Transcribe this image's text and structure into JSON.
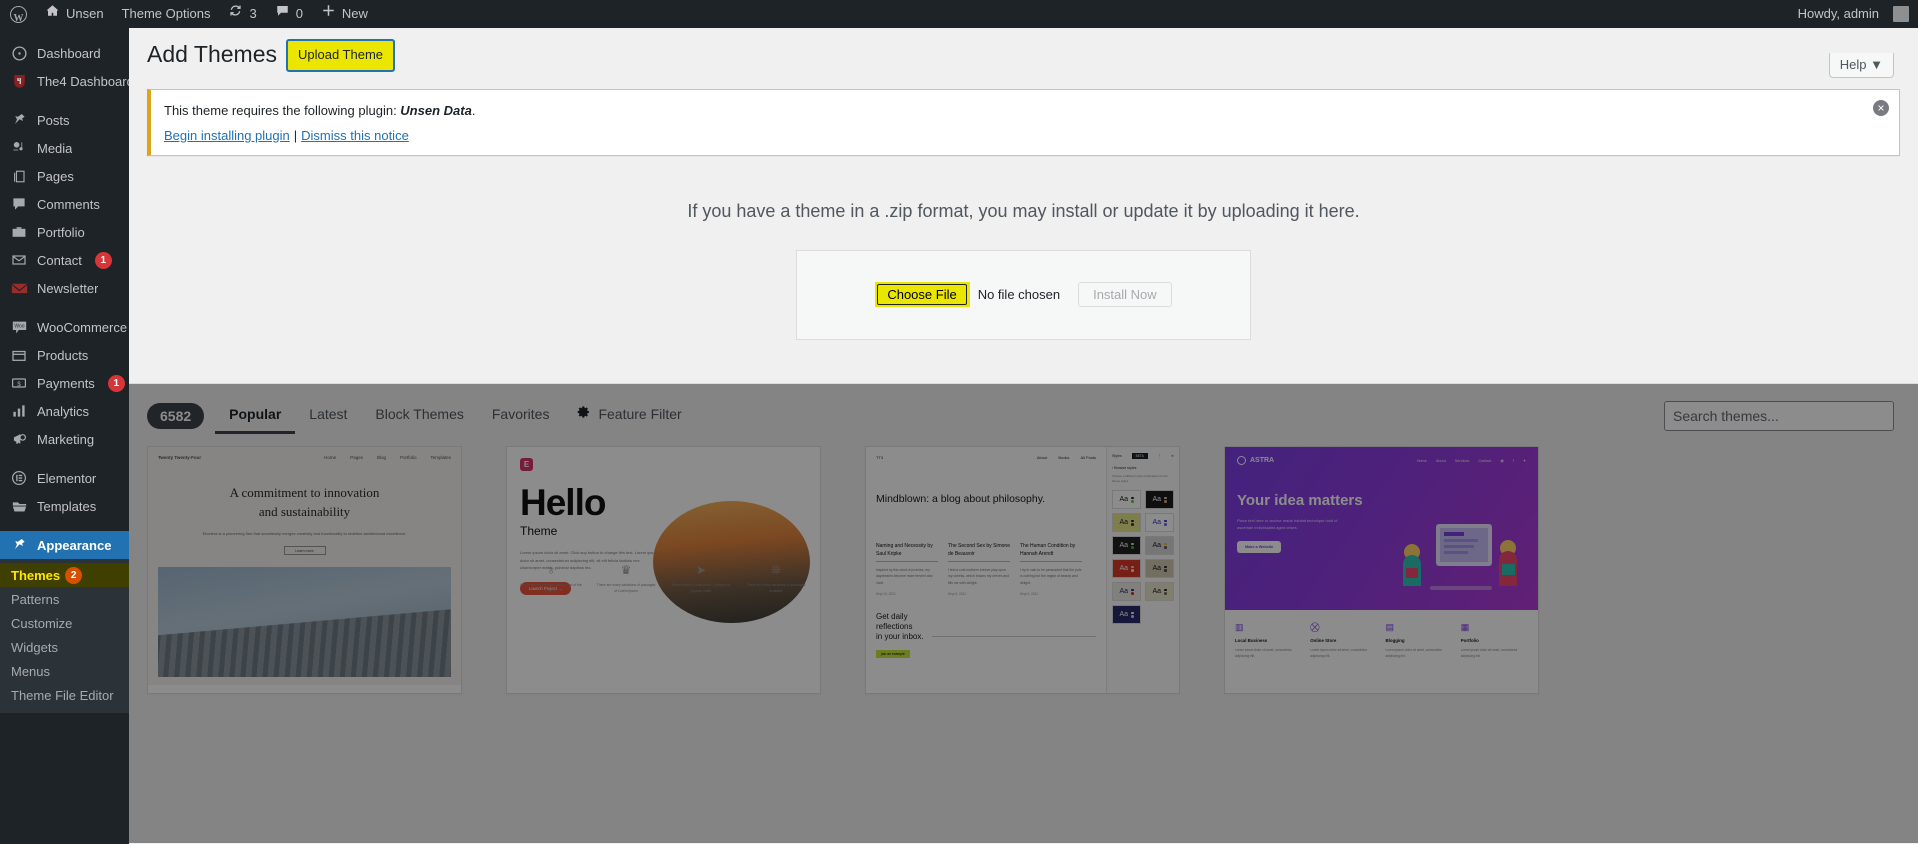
{
  "adminbar": {
    "logo_icon": "wordpress-logo-icon",
    "site_name": "Unsen",
    "theme_options": "Theme Options",
    "updates_icon": "updates-icon",
    "updates_count": "3",
    "comments_icon": "comments-icon",
    "comments_count": "0",
    "new_icon": "plus-icon",
    "new_label": "New",
    "howdy": "Howdy, admin"
  },
  "sidebar": {
    "items": [
      {
        "label": "Dashboard",
        "icon": "dashboard-icon",
        "glyph": "◍",
        "badge": null,
        "current": false,
        "sep_before": false
      },
      {
        "label": "The4 Dashboard",
        "icon": "the4-logo-icon",
        "glyph": "ᕽ",
        "badge": null,
        "current": false,
        "sep_before": false
      },
      {
        "label": "Posts",
        "icon": "pin-icon",
        "glyph": "✎",
        "badge": null,
        "current": false,
        "sep_before": true
      },
      {
        "label": "Media",
        "icon": "media-icon",
        "glyph": "♫",
        "badge": null,
        "current": false,
        "sep_before": false
      },
      {
        "label": "Pages",
        "icon": "pages-icon",
        "glyph": "❏",
        "badge": null,
        "current": false,
        "sep_before": false
      },
      {
        "label": "Comments",
        "icon": "comment-bubble-icon",
        "glyph": "◗",
        "badge": null,
        "current": false,
        "sep_before": false
      },
      {
        "label": "Portfolio",
        "icon": "portfolio-icon",
        "glyph": "▤",
        "badge": null,
        "current": false,
        "sep_before": false
      },
      {
        "label": "Contact",
        "icon": "envelope-icon",
        "glyph": "✉",
        "badge": "1",
        "current": false,
        "sep_before": false
      },
      {
        "label": "Newsletter",
        "icon": "newsletter-icon",
        "glyph": "✉",
        "badge": null,
        "current": false,
        "sep_before": false
      },
      {
        "label": "WooCommerce",
        "icon": "woocommerce-icon",
        "glyph": "W",
        "badge": null,
        "current": false,
        "sep_before": true
      },
      {
        "label": "Products",
        "icon": "products-box-icon",
        "glyph": "▭",
        "badge": null,
        "current": false,
        "sep_before": false
      },
      {
        "label": "Payments",
        "icon": "payments-icon",
        "glyph": "$",
        "badge": "1",
        "current": false,
        "sep_before": false
      },
      {
        "label": "Analytics",
        "icon": "analytics-bars-icon",
        "glyph": "▮",
        "badge": null,
        "current": false,
        "sep_before": false
      },
      {
        "label": "Marketing",
        "icon": "megaphone-icon",
        "glyph": "📣",
        "badge": null,
        "current": false,
        "sep_before": false
      },
      {
        "label": "Elementor",
        "icon": "elementor-icon",
        "glyph": "E",
        "badge": null,
        "current": false,
        "sep_before": true
      },
      {
        "label": "Templates",
        "icon": "folder-icon",
        "glyph": "▰",
        "badge": null,
        "current": false,
        "sep_before": false
      },
      {
        "label": "Appearance",
        "icon": "paintbrush-icon",
        "glyph": "✒",
        "badge": null,
        "current": true,
        "sep_before": true
      }
    ],
    "appearance_submenu": [
      {
        "label": "Themes",
        "badge": "2",
        "highlighted": true
      },
      {
        "label": "Patterns",
        "badge": null,
        "highlighted": false
      },
      {
        "label": "Customize",
        "badge": null,
        "highlighted": false
      },
      {
        "label": "Widgets",
        "badge": null,
        "highlighted": false
      },
      {
        "label": "Menus",
        "badge": null,
        "highlighted": false
      },
      {
        "label": "Theme File Editor",
        "badge": null,
        "highlighted": false
      }
    ]
  },
  "page": {
    "title": "Add Themes",
    "upload_theme_button": "Upload Theme",
    "help_tab": "Help ▼"
  },
  "notice": {
    "text_before": "This theme requires the following plugin: ",
    "plugin_name": "Unsen Data",
    "text_after": ".",
    "link_install": "Begin installing plugin",
    "separator": "|",
    "link_dismiss": "Dismiss this notice",
    "dismiss_icon": "close-circle-icon",
    "accent_color": "#dba617"
  },
  "upload": {
    "prompt": "If you have a theme in a .zip format, you may install or update it by uploading it here.",
    "choose_file_button": "Choose File",
    "no_file_text": "No file chosen",
    "install_button": "Install Now",
    "highlight_color": "#ebe600"
  },
  "browse": {
    "count": "6582",
    "tabs": [
      {
        "label": "Popular",
        "active": true,
        "icon": null
      },
      {
        "label": "Latest",
        "active": false,
        "icon": null
      },
      {
        "label": "Block Themes",
        "active": false,
        "icon": null
      },
      {
        "label": "Favorites",
        "active": false,
        "icon": null
      },
      {
        "label": "Feature Filter",
        "active": false,
        "icon": "gear-icon"
      }
    ],
    "search_placeholder": "Search themes..."
  },
  "themes": {
    "tt4": {
      "brand": "Twenty Twenty-Four",
      "nav": [
        "Home",
        "Pages",
        "Blog",
        "Portfolio",
        "Templates"
      ],
      "heading_line1": "A commitment to innovation",
      "heading_line2": "and sustainability",
      "subtext": "Etcetera is a pioneering firm that seamlessly merges creativity and functionality to redefine architectural excellence.",
      "button": "Learn more"
    },
    "hello": {
      "logo": "E",
      "heading": "Hello",
      "subheading": "Theme",
      "paragraph": "Lorem ipsum dolor sit amet. Click any button to change this text. Lorem ipsum dolor sit amet, consectetuer adipiscing elit, sit elit felicia facilisis nec ullamcorper mattis, pulvinar dapibus leo.",
      "cta": "Launch Project →",
      "features": [
        {
          "icon": "lightbulb-icon",
          "text": "Lorem ipsum is simply dummy text of the printing"
        },
        {
          "icon": "trophy-icon",
          "text": "There are many variations of passages of Lorem Ipsum"
        },
        {
          "icon": "rocket-icon",
          "text": "Where does it come from? Contrary to popular belief"
        },
        {
          "icon": "snowflake-icon",
          "text": "There are many variations of passages available"
        }
      ]
    },
    "tt3": {
      "brand": "TT3",
      "nav": [
        "About",
        "Books",
        "All Posts"
      ],
      "heading": "Mindblown: a blog about philosophy.",
      "posts": [
        {
          "title": "Naming and Necessity by Saul Kripke",
          "excerpt": "Inspired by this wind of promise, my daydreams become more fervent and vivid.",
          "date": "Sept 10, 2021"
        },
        {
          "title": "The Second Sex by Simone de Beauvoir",
          "excerpt": "I feel a cold northern breeze play upon my cheeks, which braces my nerves and fills me with delight.",
          "date": "Sept 8, 2021"
        },
        {
          "title": "The Human Condition by Hannah Arendt",
          "excerpt": "I try in vain to be persuaded that the pole is nothing but the region of beauty and delight.",
          "date": "Sept 6, 2021"
        }
      ],
      "footer_line1": "Get daily",
      "footer_line2": "reflections",
      "footer_line3": "in your inbox.",
      "footer_badge": "join an example",
      "sidebar": {
        "styles_label": "Styles",
        "beta_tag": "BETA",
        "more_icon": "kebab-menu-icon",
        "close_icon": "close-icon",
        "back_icon": "chevron-left-icon",
        "browse_styles": "Browse styles",
        "description": "Choose a different style combination for the theme styles.",
        "swatches": [
          {
            "bg": "#ffffff",
            "fg": "#1a1a1a",
            "dots": [
              "#1d2327",
              "#6cc24a"
            ]
          },
          {
            "bg": "#1d1d1d",
            "fg": "#ffffff",
            "dots": [
              "#e0d0b8",
              "#d4a373"
            ]
          },
          {
            "bg": "#e6e58d",
            "fg": "#1a1a1a",
            "dots": [
              "#1d2327",
              "#3a3a3a"
            ]
          },
          {
            "bg": "#ffffff",
            "fg": "#3a2fd0",
            "dots": [
              "#3a2fd0",
              "#6d63f0"
            ]
          },
          {
            "bg": "#222222",
            "fg": "#ffffff",
            "dots": [
              "#c9f0a0",
              "#3fae5a"
            ]
          },
          {
            "bg": "#d8d8d8",
            "fg": "#1a1a1a",
            "dots": [
              "#f0b429",
              "#5a5a5a"
            ]
          },
          {
            "bg": "#d83a2a",
            "fg": "#ffffff",
            "dots": [
              "#ffd2c0",
              "#e8e8e8"
            ]
          },
          {
            "bg": "#cfc8b0",
            "fg": "#1a1a1a",
            "dots": [
              "#1d2327",
              "#4a4a4a"
            ]
          },
          {
            "bg": "#eceae4",
            "fg": "#2b2b6b",
            "dots": [
              "#2b2b6b",
              "#c0392b"
            ]
          },
          {
            "bg": "#e9e6c8",
            "fg": "#1a1a1a",
            "dots": [
              "#1d2327",
              "#6a6a6a"
            ]
          }
        ]
      }
    },
    "astra": {
      "brand": "ASTRA",
      "nav": [
        "Home",
        "About",
        "Services",
        "Contact"
      ],
      "social": [
        "instagram-icon",
        "facebook-icon",
        "twitter-icon"
      ],
      "heading": "Your idea matters",
      "paragraph": "Place text here or anchor made habitat technique hold of ascertain individualist aged crises.",
      "button": "Make a Website",
      "features": [
        {
          "icon": "storefront-icon",
          "title": "Local Business",
          "text": "Lorem ipsum dolor sit amet, consectetur adipiscing elit."
        },
        {
          "icon": "cart-icon",
          "title": "Online Store",
          "text": "Lorem ipsum dolor sit amet, consectetur adipiscing elit."
        },
        {
          "icon": "blog-icon",
          "title": "Blogging",
          "text": "Lorem ipsum dolor sit amet, consectetur adipiscing elit."
        },
        {
          "icon": "portfolio-grid-icon",
          "title": "Portfolio",
          "text": "Lorem ipsum dolor sit amet, consectetur adipiscing elit."
        }
      ]
    }
  }
}
